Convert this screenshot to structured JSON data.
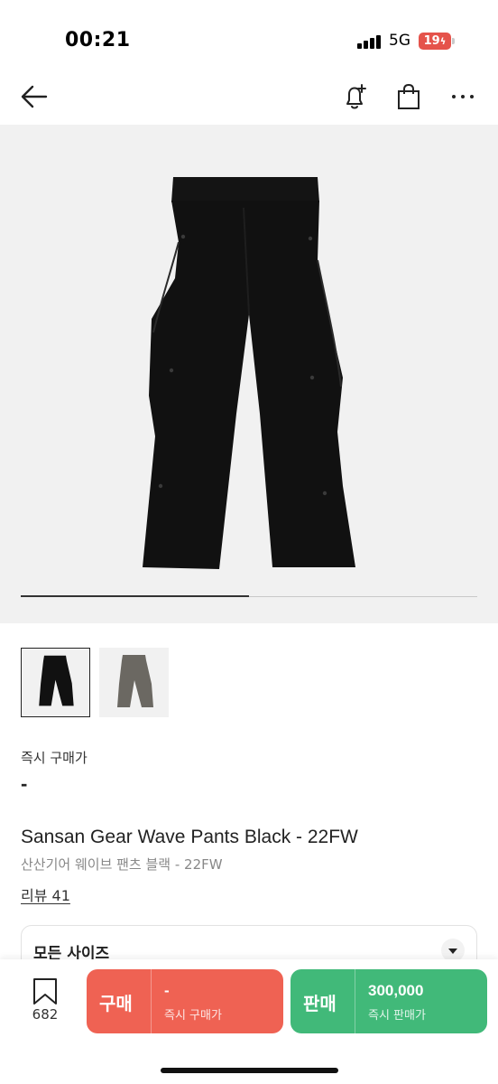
{
  "status_bar": {
    "time": "00:21",
    "network": "5G",
    "battery": "19"
  },
  "nav": {
    "icons": [
      "back-arrow-icon",
      "bell-plus-icon",
      "shopping-bag-icon",
      "more-icon"
    ]
  },
  "gallery": {
    "total_images": 2,
    "current_index": 1
  },
  "thumbnails": [
    {
      "name": "black-pants",
      "selected": true,
      "color": "#111111"
    },
    {
      "name": "grey-pants",
      "selected": false,
      "color": "#6b6862"
    }
  ],
  "product": {
    "instant_buy_label": "즉시 구매가",
    "instant_buy_price": "-",
    "title_en": "Sansan Gear Wave Pants Black - 22FW",
    "title_ko": "산산기어 웨이브 팬츠 블랙 - 22FW",
    "review_link": "리뷰 41"
  },
  "size_selector": {
    "label": "모든 사이즈"
  },
  "bottom_bar": {
    "wish_count": "682",
    "buy": {
      "label": "구매",
      "price": "-",
      "sub_label": "즉시 구매가",
      "color": "#ef6253"
    },
    "sell": {
      "label": "판매",
      "price": "300,000",
      "sub_label": "즉시 판매가",
      "color": "#41b979"
    }
  }
}
